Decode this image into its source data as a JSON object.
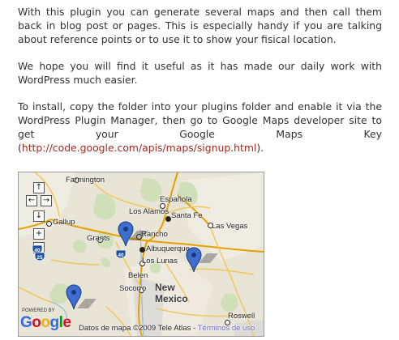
{
  "article": {
    "p1": "With this plugin you can generate several maps and then call them back in blog post or pages. This is especially handy if you are talking about reference points or to use it to show your fisical location.",
    "p2": "We hope you will find it useful as it has made our daily work with WordPress much easier.",
    "p3_text": "To install, copy the folder into your plugins folder and enable it via the WordPress Plugin Manager, then go to Google Maps developer site to get your Google Maps Key (",
    "p3_link": "http://code.google.com/apis/maps/signup.html",
    "p3_end": ")."
  },
  "map": {
    "controls": {
      "pan_up": "↑",
      "pan_left": "←",
      "pan_right": "→",
      "pan_down": "↓",
      "zoom_in": "+",
      "zoom_out": "−"
    },
    "places": {
      "farmington": "Farmington",
      "espanola": "Española",
      "los_alamos": "Los Alamos",
      "santa_fe": "Santa Fe",
      "gallup": "Gallup",
      "las_vegas": "Las Vegas",
      "grants": "Grants",
      "rancho": "Rancho",
      "albuquerque": "Albuquerque",
      "los_lunas": "Los Lunas",
      "belen": "Belen",
      "socorro": "Socorro",
      "new_mexico_1": "New",
      "new_mexico_2": "Mexico",
      "roswell": "Roswell"
    },
    "shields": {
      "i40_west": "40",
      "i40_albuquerque": "40",
      "i25": "25"
    },
    "logo": {
      "powered_by": "POWERED BY",
      "letters": [
        "G",
        "o",
        "o",
        "g",
        "l",
        "e"
      ],
      "colors": [
        "#3369e8",
        "#d50f25",
        "#eeb211",
        "#3369e8",
        "#009925",
        "#d50f25"
      ]
    },
    "attribution": {
      "text": "Datos de mapa ©2009 Tele Atlas - ",
      "terms": "Términos de uso"
    }
  }
}
